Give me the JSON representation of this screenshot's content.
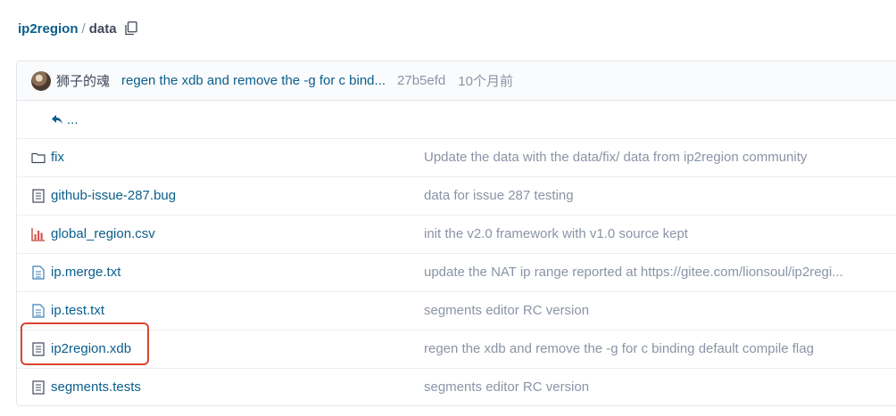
{
  "breadcrumb": {
    "repo": "ip2region",
    "separator": "/",
    "folder": "data"
  },
  "last_commit": {
    "author": "狮子的魂",
    "message": "regen the xdb and remove the -g for c bind...",
    "sha": "27b5efd",
    "time": "10个月前"
  },
  "parent_link": "...",
  "files": [
    {
      "name": "fix",
      "type": "folder",
      "icon": "folder-icon",
      "message": "Update the data with the data/fix/ data from ip2region community"
    },
    {
      "name": "github-issue-287.bug",
      "type": "file",
      "icon": "file-text-icon",
      "message": "data for issue 287 testing"
    },
    {
      "name": "global_region.csv",
      "type": "csv",
      "icon": "bar-chart-icon",
      "message": "init the v2.0 framework with v1.0 source kept"
    },
    {
      "name": "ip.merge.txt",
      "type": "txt",
      "icon": "file-text-icon",
      "message": "update the NAT ip range reported at https://gitee.com/lionsoul/ip2regi..."
    },
    {
      "name": "ip.test.txt",
      "type": "txt",
      "icon": "file-text-icon",
      "message": "segments editor RC version"
    },
    {
      "name": "ip2region.xdb",
      "type": "file",
      "icon": "file-text-icon",
      "message": "regen the xdb and remove the -g for c binding default compile flag"
    },
    {
      "name": "segments.tests",
      "type": "file",
      "icon": "file-text-icon",
      "message": "segments editor RC version"
    }
  ],
  "colors": {
    "link": "#0a5e8c",
    "muted": "#8a94a6",
    "highlight": "#d9452f"
  }
}
